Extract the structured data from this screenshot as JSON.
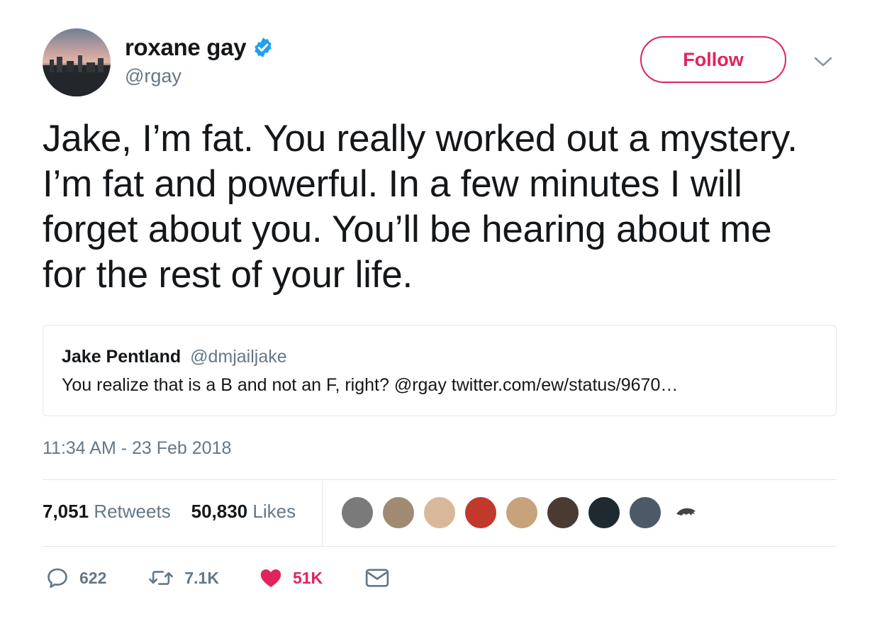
{
  "author": {
    "display_name": "roxane gay",
    "handle": "@rgay",
    "verified": true
  },
  "follow_label": "Follow",
  "tweet": {
    "text": "Jake, I’m fat. You really worked out a mystery. I’m fat and powerful. In a few minutes I will forget about you. You’ll be hearing about me for the rest of your life."
  },
  "quoted_tweet": {
    "name": "Jake Pentland",
    "handle": "@dmjailjake",
    "text": "You realize that is a B and not an F, right? @rgay twitter.com/ew/status/9670…"
  },
  "timestamp": "11:34 AM - 23 Feb 2018",
  "stats": {
    "retweets_count": "7,051",
    "retweets_label": "Retweets",
    "likes_count": "50,830",
    "likes_label": "Likes"
  },
  "likers": [
    {
      "color": "#7a7a7a"
    },
    {
      "color": "#a08a72"
    },
    {
      "color": "#d9b89a"
    },
    {
      "color": "#c0392b"
    },
    {
      "color": "#c7a27a"
    },
    {
      "color": "#4a3a32"
    },
    {
      "color": "#1f2a30"
    },
    {
      "color": "#4b5a66"
    },
    {
      "color": "#ffffff"
    }
  ],
  "actions": {
    "replies": "622",
    "retweets": "7.1K",
    "likes": "51K"
  },
  "colors": {
    "follow_accent": "#e0245e",
    "verified_blue": "#1da1f2",
    "muted": "#657786",
    "like_red": "#e0245e"
  }
}
